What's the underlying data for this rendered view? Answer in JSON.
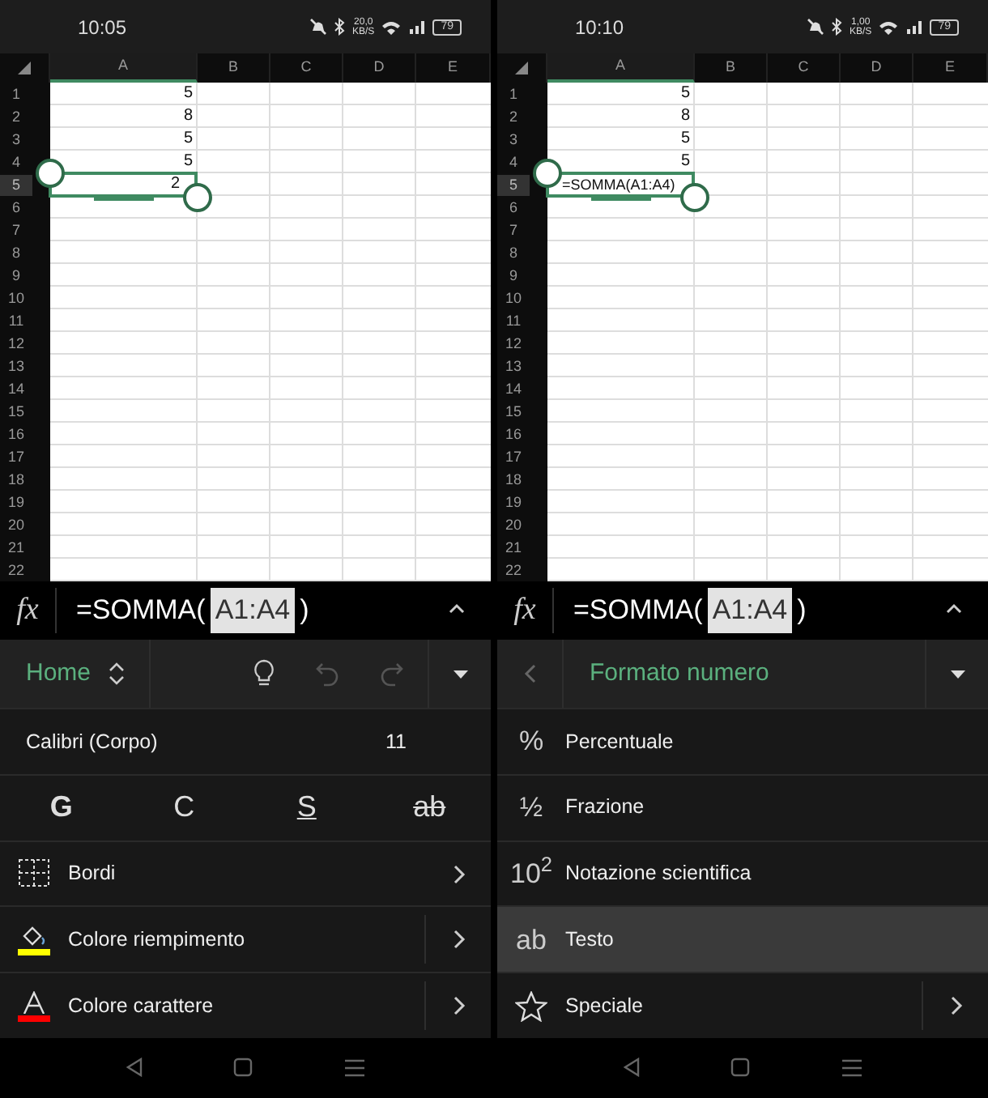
{
  "screens": [
    {
      "status_bar": {
        "time": "10:05",
        "speed": "20,0",
        "speed_unit": "KB/S",
        "battery": "79"
      },
      "sheet": {
        "columns": [
          {
            "label": "A",
            "selected": true
          },
          {
            "label": "B",
            "selected": false
          },
          {
            "label": "C",
            "selected": false
          },
          {
            "label": "D",
            "selected": false
          },
          {
            "label": "E",
            "selected": false
          }
        ],
        "rows": [
          {
            "label": "1",
            "selected": false,
            "cells": [
              {
                "text": "5",
                "kind": "number"
              }
            ]
          },
          {
            "label": "2",
            "selected": false,
            "cells": [
              {
                "text": "8",
                "kind": "number"
              }
            ]
          },
          {
            "label": "3",
            "selected": false,
            "cells": [
              {
                "text": "5",
                "kind": "number"
              }
            ]
          },
          {
            "label": "4",
            "selected": false,
            "cells": [
              {
                "text": "5",
                "kind": "number"
              }
            ]
          },
          {
            "label": "5",
            "selected": true,
            "cells": [
              {
                "text": "2",
                "kind": "number"
              }
            ]
          },
          {
            "label": "6",
            "selected": false
          },
          {
            "label": "7",
            "selected": false
          },
          {
            "label": "8",
            "selected": false
          },
          {
            "label": "9",
            "selected": false
          },
          {
            "label": "10",
            "selected": false
          },
          {
            "label": "11",
            "selected": false
          },
          {
            "label": "12",
            "selected": false
          },
          {
            "label": "13",
            "selected": false
          },
          {
            "label": "14",
            "selected": false
          },
          {
            "label": "15",
            "selected": false
          },
          {
            "label": "16",
            "selected": false
          },
          {
            "label": "17",
            "selected": false
          },
          {
            "label": "18",
            "selected": false
          },
          {
            "label": "19",
            "selected": false
          },
          {
            "label": "20",
            "selected": false
          },
          {
            "label": "21",
            "selected": false
          },
          {
            "label": "22",
            "selected": false
          }
        ]
      },
      "formula_bar": {
        "fx": "fx",
        "before": "=SOMMA(",
        "reference": "A1:A4",
        "after": ")"
      },
      "ribbon": {
        "kind": "home",
        "title": "Home",
        "undo_disabled": true,
        "redo_disabled": true
      },
      "items": [
        {
          "kind": "font",
          "font": "Calibri (Corpo)",
          "size": "11"
        },
        {
          "kind": "styles",
          "buttons": [
            {
              "label": "G",
              "kind": "bold"
            },
            {
              "label": "C",
              "kind": "italic"
            },
            {
              "label": "S",
              "kind": "underline"
            },
            {
              "label": "ab",
              "kind": "strike"
            }
          ]
        },
        {
          "kind": "borders",
          "label": "Bordi",
          "submenu": true,
          "split": false
        },
        {
          "kind": "fill",
          "color": "#ffff00",
          "label": "Colore riempimento",
          "submenu": true,
          "split": true
        },
        {
          "kind": "font-color",
          "color": "#ff0000",
          "label": "Colore carattere",
          "submenu": true,
          "split": true
        }
      ]
    },
    {
      "status_bar": {
        "time": "10:10",
        "speed": "1,00",
        "speed_unit": "KB/S",
        "battery": "79"
      },
      "sheet": {
        "columns": [
          {
            "label": "A",
            "selected": true
          },
          {
            "label": "B",
            "selected": false
          },
          {
            "label": "C",
            "selected": false
          },
          {
            "label": "D",
            "selected": false
          },
          {
            "label": "E",
            "selected": false
          }
        ],
        "rows": [
          {
            "label": "1",
            "selected": false,
            "cells": [
              {
                "text": "5",
                "kind": "number"
              }
            ]
          },
          {
            "label": "2",
            "selected": false,
            "cells": [
              {
                "text": "8",
                "kind": "number"
              }
            ]
          },
          {
            "label": "3",
            "selected": false,
            "cells": [
              {
                "text": "5",
                "kind": "number"
              }
            ]
          },
          {
            "label": "4",
            "selected": false,
            "cells": [
              {
                "text": "5",
                "kind": "number"
              }
            ]
          },
          {
            "label": "5",
            "selected": true,
            "cells": [
              {
                "text": "=SOMMA(A1:A4)",
                "kind": "text"
              }
            ]
          },
          {
            "label": "6",
            "selected": false
          },
          {
            "label": "7",
            "selected": false
          },
          {
            "label": "8",
            "selected": false
          },
          {
            "label": "9",
            "selected": false
          },
          {
            "label": "10",
            "selected": false
          },
          {
            "label": "11",
            "selected": false
          },
          {
            "label": "12",
            "selected": false
          },
          {
            "label": "13",
            "selected": false
          },
          {
            "label": "14",
            "selected": false
          },
          {
            "label": "15",
            "selected": false
          },
          {
            "label": "16",
            "selected": false
          },
          {
            "label": "17",
            "selected": false
          },
          {
            "label": "18",
            "selected": false
          },
          {
            "label": "19",
            "selected": false
          },
          {
            "label": "20",
            "selected": false
          },
          {
            "label": "21",
            "selected": false
          },
          {
            "label": "22",
            "selected": false
          }
        ]
      },
      "formula_bar": {
        "fx": "fx",
        "before": "=SOMMA(",
        "reference": "A1:A4",
        "after": ")"
      },
      "ribbon": {
        "kind": "back",
        "title": "Formato numero"
      },
      "items": [
        {
          "kind": "glyph",
          "glyph": "%",
          "label": "Percentuale",
          "selected": false,
          "submenu": false,
          "split": false
        },
        {
          "kind": "glyph",
          "glyph": "½",
          "label": "Frazione",
          "selected": false,
          "submenu": false,
          "split": false
        },
        {
          "kind": "glyph",
          "glyph": "10$^{2}$",
          "label": "Notazione scientifica",
          "selected": false,
          "submenu": false,
          "split": false
        },
        {
          "kind": "glyph",
          "glyph": "ab",
          "label": "Testo",
          "selected": true,
          "submenu": false,
          "split": false
        },
        {
          "kind": "star",
          "label": "Speciale",
          "selected": false,
          "submenu": true,
          "split": true
        }
      ]
    }
  ]
}
